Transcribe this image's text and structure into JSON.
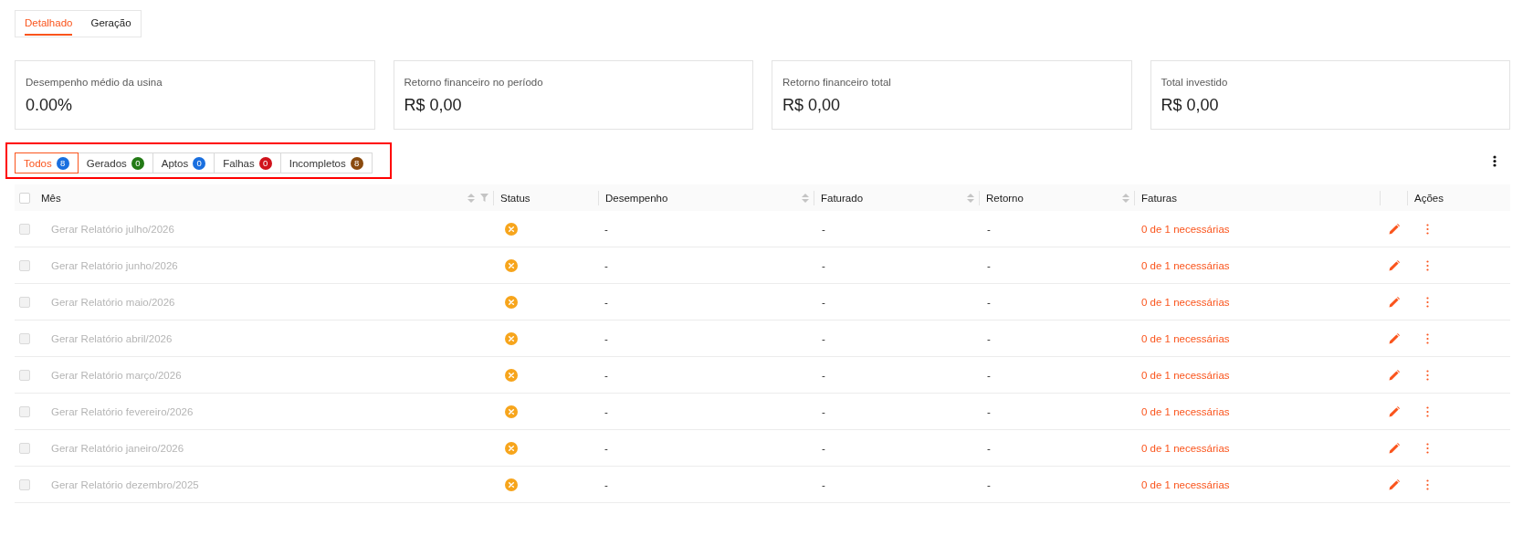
{
  "view_tabs": [
    {
      "label": "Detalhado",
      "selected": true
    },
    {
      "label": "Geração",
      "selected": false
    }
  ],
  "summary_cards": [
    {
      "label": "Desempenho médio da usina",
      "value": "0.00%"
    },
    {
      "label": "Retorno financeiro no período",
      "value": "R$ 0,00"
    },
    {
      "label": "Retorno financeiro total",
      "value": "R$ 0,00"
    },
    {
      "label": "Total investido",
      "value": "R$ 0,00"
    }
  ],
  "filter_tabs": {
    "highlighted": true,
    "items": [
      {
        "label": "Todos",
        "count": "8",
        "color": "#1a6fdf",
        "selected": true
      },
      {
        "label": "Gerados",
        "count": "0",
        "color": "#237a16",
        "selected": false
      },
      {
        "label": "Aptos",
        "count": "0",
        "color": "#1a6fdf",
        "selected": false
      },
      {
        "label": "Falhas",
        "count": "0",
        "color": "#d0121b",
        "selected": false
      },
      {
        "label": "Incompletos",
        "count": "8",
        "color": "#8a4a0e",
        "selected": false
      }
    ]
  },
  "table": {
    "select_all": {
      "checked": false
    },
    "columns": [
      {
        "label": "Mês",
        "sortable": true,
        "filterable": true
      },
      {
        "label": "Status",
        "sortable": false,
        "filterable": false
      },
      {
        "label": "Desempenho",
        "sortable": true,
        "filterable": false
      },
      {
        "label": "Faturado",
        "sortable": true,
        "filterable": false
      },
      {
        "label": "Retorno",
        "sortable": true,
        "filterable": false
      },
      {
        "label": "Faturas",
        "sortable": false,
        "filterable": false
      },
      {
        "label": "Ações",
        "sortable": false,
        "filterable": false
      }
    ],
    "rows": [
      {
        "month": "Gerar Relatório julho/2026",
        "checked": false,
        "disabled": true,
        "status": {
          "kind": "incomplete"
        },
        "desempenho": "-",
        "faturado": "-",
        "retorno": "-",
        "faturas": "0 de 1 necessárias"
      },
      {
        "month": "Gerar Relatório junho/2026",
        "checked": false,
        "disabled": true,
        "status": {
          "kind": "incomplete"
        },
        "desempenho": "-",
        "faturado": "-",
        "retorno": "-",
        "faturas": "0 de 1 necessárias"
      },
      {
        "month": "Gerar Relatório maio/2026",
        "checked": false,
        "disabled": true,
        "status": {
          "kind": "incomplete"
        },
        "desempenho": "-",
        "faturado": "-",
        "retorno": "-",
        "faturas": "0 de 1 necessárias"
      },
      {
        "month": "Gerar Relatório abril/2026",
        "checked": false,
        "disabled": true,
        "status": {
          "kind": "incomplete"
        },
        "desempenho": "-",
        "faturado": "-",
        "retorno": "-",
        "faturas": "0 de 1 necessárias"
      },
      {
        "month": "Gerar Relatório março/2026",
        "checked": false,
        "disabled": true,
        "status": {
          "kind": "incomplete"
        },
        "desempenho": "-",
        "faturado": "-",
        "retorno": "-",
        "faturas": "0 de 1 necessárias"
      },
      {
        "month": "Gerar Relatório fevereiro/2026",
        "checked": false,
        "disabled": true,
        "status": {
          "kind": "incomplete"
        },
        "desempenho": "-",
        "faturado": "-",
        "retorno": "-",
        "faturas": "0 de 1 necessárias"
      },
      {
        "month": "Gerar Relatório janeiro/2026",
        "checked": false,
        "disabled": true,
        "status": {
          "kind": "incomplete"
        },
        "desempenho": "-",
        "faturado": "-",
        "retorno": "-",
        "faturas": "0 de 1 necessárias"
      },
      {
        "month": "Gerar Relatório dezembro/2025",
        "checked": false,
        "disabled": true,
        "status": {
          "kind": "incomplete"
        },
        "desempenho": "-",
        "faturado": "-",
        "retorno": "-",
        "faturas": "0 de 1 necessárias"
      }
    ]
  }
}
